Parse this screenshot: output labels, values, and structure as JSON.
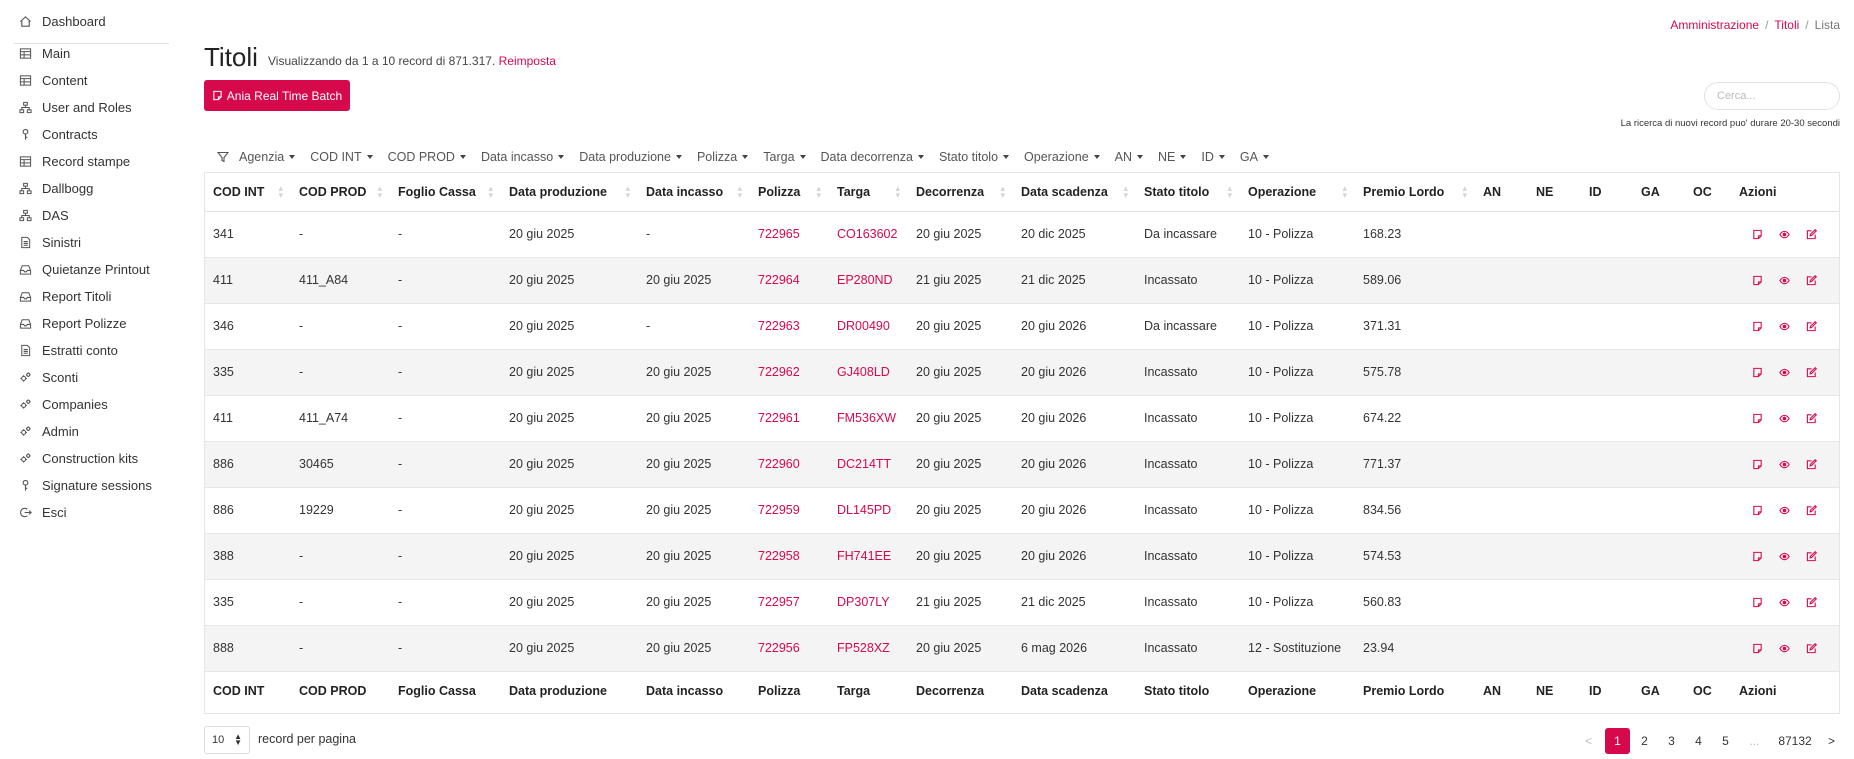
{
  "sidebar": {
    "items": [
      {
        "label": "Dashboard",
        "icon": "home-icon"
      },
      {
        "label": "Main",
        "icon": "grid-icon"
      },
      {
        "label": "Content",
        "icon": "grid-icon"
      },
      {
        "label": "User and Roles",
        "icon": "sitemap-icon"
      },
      {
        "label": "Contracts",
        "icon": "key-icon"
      },
      {
        "label": "Record stampe",
        "icon": "grid-icon"
      },
      {
        "label": "Dallbogg",
        "icon": "sitemap-icon"
      },
      {
        "label": "DAS",
        "icon": "sitemap-icon"
      },
      {
        "label": "Sinistri",
        "icon": "file-icon"
      },
      {
        "label": "Quietanze Printout",
        "icon": "inbox-icon"
      },
      {
        "label": "Report Titoli",
        "icon": "inbox-icon"
      },
      {
        "label": "Report Polizze",
        "icon": "inbox-icon"
      },
      {
        "label": "Estratti conto",
        "icon": "file-icon"
      },
      {
        "label": "Sconti",
        "icon": "cogs-icon"
      },
      {
        "label": "Companies",
        "icon": "cogs-icon"
      },
      {
        "label": "Admin",
        "icon": "cogs-icon"
      },
      {
        "label": "Construction kits",
        "icon": "cogs-icon"
      },
      {
        "label": "Signature sessions",
        "icon": "key-icon"
      },
      {
        "label": "Esci",
        "icon": "logout-icon"
      }
    ]
  },
  "breadcrumb": {
    "item1": "Amministrazione",
    "item2": "Titoli",
    "current": "Lista",
    "separator": "/"
  },
  "header": {
    "title": "Titoli",
    "subtitle": "Visualizzando da 1 a 10 record di 871.317.",
    "reset_label": "Reimposta",
    "batch_button": "Ania Real Time Batch"
  },
  "search": {
    "placeholder": "Cerca...",
    "note": "La ricerca di nuovi record puo' durare 20-30 secondi"
  },
  "filters": [
    "Agenzia",
    "COD INT",
    "COD PROD",
    "Data incasso",
    "Data produzione",
    "Polizza",
    "Targa",
    "Data decorrenza",
    "Stato titolo",
    "Operazione",
    "AN",
    "NE",
    "ID",
    "GA"
  ],
  "table": {
    "columns": [
      "COD INT",
      "COD PROD",
      "Foglio Cassa",
      "Data produzione",
      "Data incasso",
      "Polizza",
      "Targa",
      "Decorrenza",
      "Data scadenza",
      "Stato titolo",
      "Operazione",
      "Premio Lordo",
      "AN",
      "NE",
      "ID",
      "GA",
      "OC",
      "Azioni"
    ],
    "rows": [
      [
        "341",
        "-",
        "-",
        "20 giu 2025",
        "-",
        "722965",
        "CO163602",
        "20 giu 2025",
        "20 dic 2025",
        "Da incassare",
        "10 - Polizza",
        "168.23",
        "",
        "",
        "",
        "",
        ""
      ],
      [
        "411",
        "411_A84",
        "-",
        "20 giu 2025",
        "20 giu 2025",
        "722964",
        "EP280ND",
        "21 giu 2025",
        "21 dic 2025",
        "Incassato",
        "10 - Polizza",
        "589.06",
        "",
        "",
        "",
        "",
        ""
      ],
      [
        "346",
        "-",
        "-",
        "20 giu 2025",
        "-",
        "722963",
        "DR00490",
        "20 giu 2025",
        "20 giu 2026",
        "Da incassare",
        "10 - Polizza",
        "371.31",
        "",
        "",
        "",
        "",
        ""
      ],
      [
        "335",
        "-",
        "-",
        "20 giu 2025",
        "20 giu 2025",
        "722962",
        "GJ408LD",
        "20 giu 2025",
        "20 giu 2026",
        "Incassato",
        "10 - Polizza",
        "575.78",
        "",
        "",
        "",
        "",
        ""
      ],
      [
        "411",
        "411_A74",
        "-",
        "20 giu 2025",
        "20 giu 2025",
        "722961",
        "FM536XW",
        "20 giu 2025",
        "20 giu 2026",
        "Incassato",
        "10 - Polizza",
        "674.22",
        "",
        "",
        "",
        "",
        ""
      ],
      [
        "886",
        "30465",
        "-",
        "20 giu 2025",
        "20 giu 2025",
        "722960",
        "DC214TT",
        "20 giu 2025",
        "20 giu 2026",
        "Incassato",
        "10 - Polizza",
        "771.37",
        "",
        "",
        "",
        "",
        ""
      ],
      [
        "886",
        "19229",
        "-",
        "20 giu 2025",
        "20 giu 2025",
        "722959",
        "DL145PD",
        "20 giu 2025",
        "20 giu 2026",
        "Incassato",
        "10 - Polizza",
        "834.56",
        "",
        "",
        "",
        "",
        ""
      ],
      [
        "388",
        "-",
        "-",
        "20 giu 2025",
        "20 giu 2025",
        "722958",
        "FH741EE",
        "20 giu 2025",
        "20 giu 2026",
        "Incassato",
        "10 - Polizza",
        "574.53",
        "",
        "",
        "",
        "",
        ""
      ],
      [
        "335",
        "-",
        "-",
        "20 giu 2025",
        "20 giu 2025",
        "722957",
        "DP307LY",
        "21 giu 2025",
        "21 dic 2025",
        "Incassato",
        "10 - Polizza",
        "560.83",
        "",
        "",
        "",
        "",
        ""
      ],
      [
        "888",
        "-",
        "-",
        "20 giu 2025",
        "20 giu 2025",
        "722956",
        "FP528XZ",
        "20 giu 2025",
        "6 mag 2026",
        "Incassato",
        "12 - Sostituzione",
        "23.94",
        "",
        "",
        "",
        "",
        ""
      ]
    ]
  },
  "footer": {
    "per_page_value": "10",
    "per_page_label": "record per pagina",
    "pagination": {
      "prev": "<",
      "pages": [
        "1",
        "2",
        "3",
        "4",
        "5"
      ],
      "ellipsis": "...",
      "last": "87132",
      "next": ">",
      "current": "1"
    }
  },
  "colors": {
    "accent": "#d6094c"
  }
}
